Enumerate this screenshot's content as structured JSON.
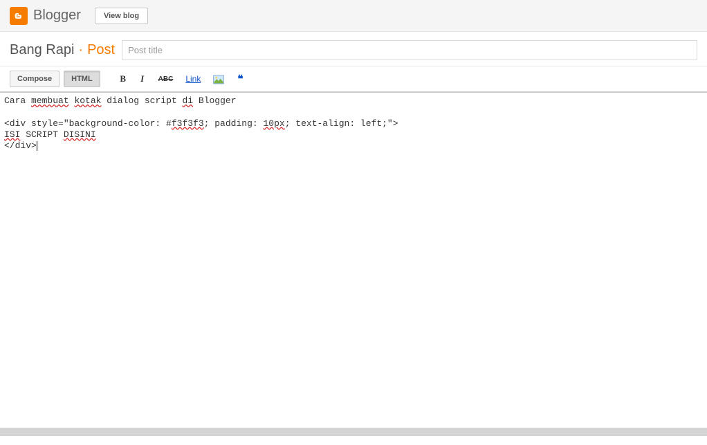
{
  "header": {
    "brand": "Blogger",
    "view_blog": "View blog"
  },
  "title_row": {
    "blog_name": "Bang Rapi",
    "separator": "·",
    "post_label": "Post",
    "post_title_placeholder": "Post title",
    "post_title_value": ""
  },
  "toolbar": {
    "compose": "Compose",
    "html": "HTML",
    "bold": "B",
    "italic": "I",
    "strike": "ABC",
    "link": "Link",
    "quote": "❝"
  },
  "editor": {
    "line1_a": "Cara ",
    "line1_b": "membuat",
    "line1_c": " ",
    "line1_d": "kotak",
    "line1_e": " dialog script ",
    "line1_f": "di",
    "line1_g": " Blogger",
    "line2": "",
    "line3_a": "<div style=\"background-color: #",
    "line3_b": "f3f3f3",
    "line3_c": "; padding: ",
    "line3_d": "10px",
    "line3_e": "; text-align: left;\">",
    "line4_a": "ISI",
    "line4_b": " SCRIPT ",
    "line4_c": "DISINI",
    "line5": "</div>"
  }
}
